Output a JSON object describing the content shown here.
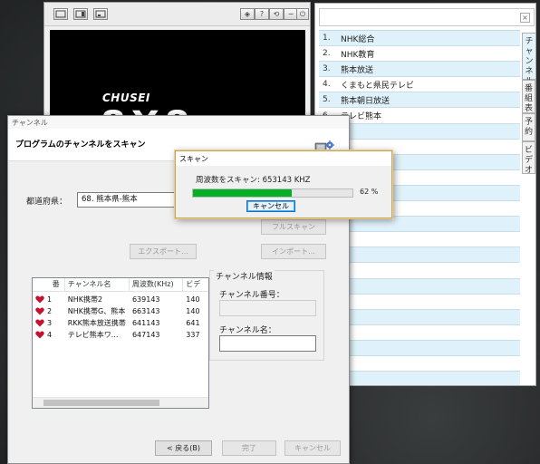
{
  "player": {
    "logo_small": "CHUSEI",
    "logo_big": "8X8",
    "toolbar_icons": [
      "view-single-icon",
      "view-split-icon",
      "view-picture-icon",
      "home-icon",
      "help-icon",
      "restore-icon",
      "minimize-icon",
      "power-icon"
    ],
    "toolbar_glyphs": [
      "◈",
      "?",
      "⟲",
      "−",
      "⏻"
    ]
  },
  "channel_panel": {
    "clear_glyph": "×",
    "channels": [
      {
        "num": "1.",
        "name": "NHK総合"
      },
      {
        "num": "2.",
        "name": "NHK教育"
      },
      {
        "num": "3.",
        "name": "熊本放送"
      },
      {
        "num": "4.",
        "name": "くまもと県民テレビ"
      },
      {
        "num": "5.",
        "name": "熊本朝日放送"
      },
      {
        "num": "6.",
        "name": "テレビ熊本"
      },
      {
        "num": "",
        "name": ""
      },
      {
        "num": "",
        "name": ""
      },
      {
        "num": "",
        "name": ""
      },
      {
        "num": "",
        "name": ""
      },
      {
        "num": "",
        "name": ""
      },
      {
        "num": "",
        "name": ""
      },
      {
        "num": "",
        "name": ""
      },
      {
        "num": "",
        "name": ""
      },
      {
        "num": "",
        "name": ""
      },
      {
        "num": "",
        "name": ""
      },
      {
        "num": "",
        "name": ""
      },
      {
        "num": "",
        "name": ""
      },
      {
        "num": "",
        "name": ""
      },
      {
        "num": "",
        "name": ""
      },
      {
        "num": "",
        "name": ""
      },
      {
        "num": "",
        "name": ""
      },
      {
        "num": "",
        "name": ""
      }
    ],
    "tabs": [
      "チャンネル",
      "番組表",
      "予約",
      "ビデオ"
    ]
  },
  "scan_dialog": {
    "window_title": "チャンネル",
    "header_title": "プログラムのチャンネルをスキャン",
    "prefecture_label": "都道府県：",
    "prefecture_value": "68. 熊本県-熊本",
    "full_scan_label": "フルスキャン",
    "export_label": "エクスポート...",
    "import_label": "インポート...",
    "columns": [
      "番",
      "チャンネル名",
      "周波数(KHz)",
      "ビデ"
    ],
    "rows": [
      {
        "num": "1",
        "name": "NHK携帯2",
        "freq": "639143",
        "video": "140"
      },
      {
        "num": "2",
        "name": "NHK携帯G、熊本",
        "freq": "663143",
        "video": "140"
      },
      {
        "num": "3",
        "name": "RKK熊本放送携帯",
        "freq": "641143",
        "video": "641"
      },
      {
        "num": "4",
        "name": "テレビ熊本ワ...",
        "freq": "647143",
        "video": "337"
      }
    ],
    "info_group_label": "チャンネル情報",
    "channel_number_label": "チャンネル番号：",
    "channel_name_label": "チャンネル名：",
    "back_label": "< 戻る(B)",
    "finish_label": "完了",
    "cancel_label": "キャンセル"
  },
  "progress_dialog": {
    "title": "スキャン",
    "status_text": "周波数をスキャン: 653143 KHZ",
    "progress_percent": 62,
    "percent_text": "62 %",
    "cancel_label": "キャンセル"
  },
  "colors": {
    "progress_fill": "#06b025",
    "list_row_alt": "#dff1fa",
    "heart": "#c8102e"
  }
}
